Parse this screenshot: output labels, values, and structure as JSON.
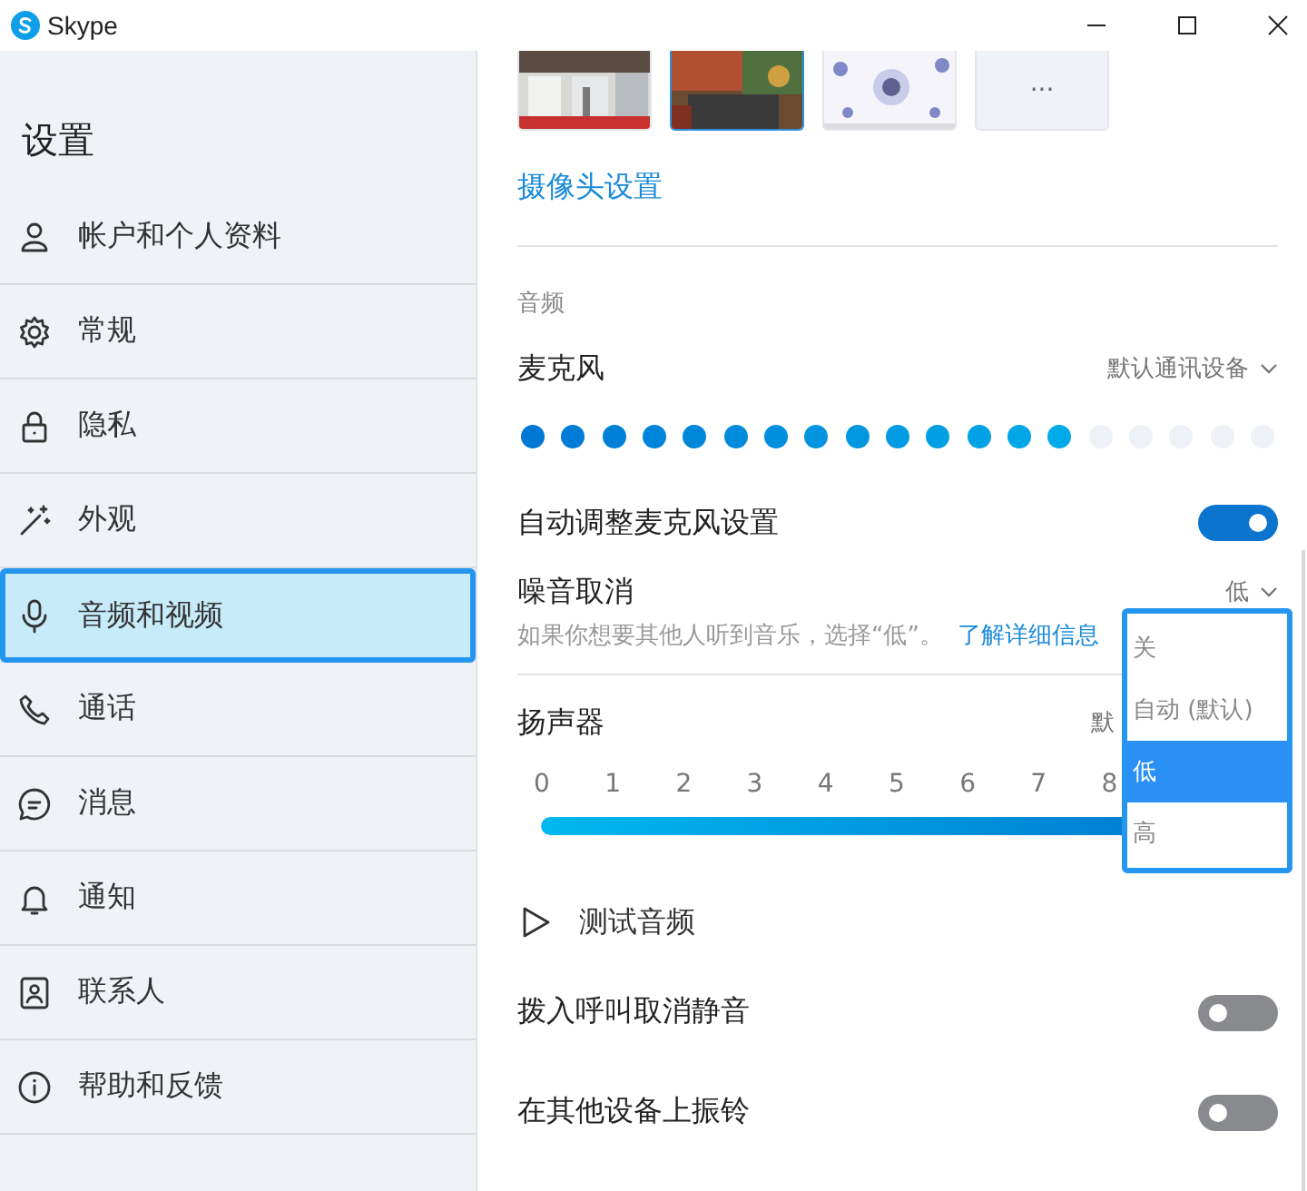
{
  "window": {
    "title": "Skype"
  },
  "sidebar": {
    "title": "设置",
    "items": [
      {
        "label": "帐户和个人资料",
        "selected": false
      },
      {
        "label": "常规",
        "selected": false
      },
      {
        "label": "隐私",
        "selected": false
      },
      {
        "label": "外观",
        "selected": false
      },
      {
        "label": "音频和视频",
        "selected": true
      },
      {
        "label": "通话",
        "selected": false
      },
      {
        "label": "消息",
        "selected": false
      },
      {
        "label": "通知",
        "selected": false
      },
      {
        "label": "联系人",
        "selected": false
      },
      {
        "label": "帮助和反馈",
        "selected": false
      }
    ]
  },
  "cameras": [
    {
      "kind": "picture",
      "selected": false
    },
    {
      "kind": "picture",
      "selected": true
    },
    {
      "kind": "picture",
      "selected": false
    },
    {
      "kind": "more",
      "label": "···",
      "selected": false
    }
  ],
  "camera_settings_link": "摄像头设置",
  "section_heading": "音频",
  "microphone": {
    "label": "麦克风",
    "device": "默认通讯设备",
    "level": 0.7368
  },
  "auto_adjust": {
    "label": "自动调整麦克风设置",
    "on": true
  },
  "noise_cancellation": {
    "label": "噪音取消",
    "value": "低",
    "hint": "如果你想要其他人听到音乐，选择“低”。",
    "link": "了解详细信息",
    "options": [
      {
        "label": "关",
        "selected": false
      },
      {
        "label": "自动 (默认)",
        "selected": false
      },
      {
        "label": "低",
        "selected": true
      },
      {
        "label": "高",
        "selected": false
      }
    ]
  },
  "speaker": {
    "label": "扬声器",
    "device": "默",
    "ticks": [
      "0",
      "1",
      "2",
      "3",
      "4",
      "5",
      "6",
      "7",
      "8"
    ],
    "level": 1
  },
  "test_audio": "测试音频",
  "toggles": [
    {
      "label": "拨入呼叫取消静音",
      "on": false
    },
    {
      "label": "在其他设备上振铃",
      "on": false
    }
  ]
}
